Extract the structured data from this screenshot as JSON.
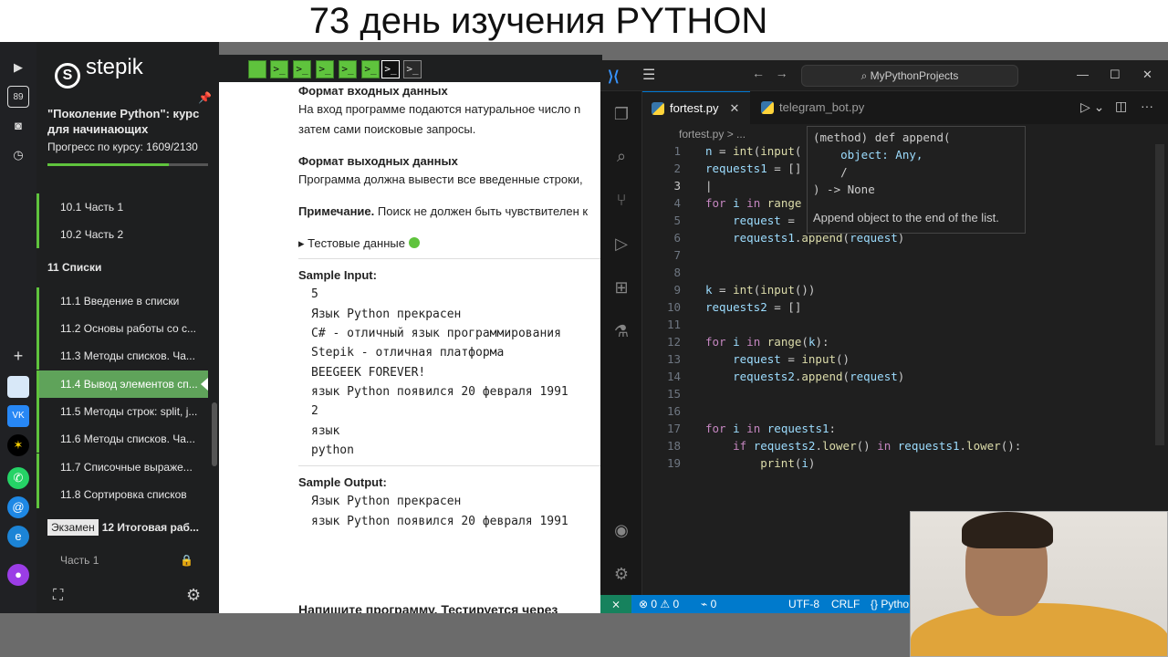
{
  "banner": {
    "title": "73 день изучения PYTHON"
  },
  "os_sidebar": {
    "badge": "89"
  },
  "stepik": {
    "logo": "stepik",
    "course_title": "\"Поколение Python\": курс для начинающих",
    "progress_text": "Прогресс по курсу:  1609/2130",
    "progress_value": 0.755,
    "menu": [
      {
        "label": "10.1  Часть 1",
        "type": "sub"
      },
      {
        "label": "10.2  Часть 2",
        "type": "sub"
      },
      {
        "label": "11  Списки",
        "type": "section"
      },
      {
        "label": "11.1  Введение в списки",
        "type": "sub"
      },
      {
        "label": "11.2  Основы работы со с...",
        "type": "sub"
      },
      {
        "label": "11.3  Методы списков. Ча...",
        "type": "sub"
      },
      {
        "label": "11.4  Вывод элементов сп...",
        "type": "active"
      },
      {
        "label": "11.5  Методы строк: split, j...",
        "type": "sub"
      },
      {
        "label": "11.6  Методы списков. Ча...",
        "type": "sub"
      },
      {
        "label": "11.7  Списочные выраже...",
        "type": "sub"
      },
      {
        "label": "11.8  Сортировка списков",
        "type": "sub"
      },
      {
        "label": "12  Итоговая раб...",
        "type": "exam",
        "badge": "Экзамен"
      },
      {
        "label": "Часть 1",
        "type": "locked"
      }
    ],
    "steps": [
      ">_",
      ">_",
      ">_",
      ">_",
      ">_",
      ">_",
      ">_"
    ],
    "content": {
      "input_format_title": "Формат входных данных",
      "input_format_line1": "На вход программе подаются натуральное число n",
      "input_format_line2": "затем сами поисковые запросы.",
      "output_format_title": "Формат выходных данных",
      "output_format_text": "Программа должна вывести все введенные строки,",
      "note_bold": "Примечание.",
      "note_text": " Поиск не должен быть чувствителен к",
      "tests_label": "Тестовые данные",
      "sample_input_title": "Sample Input:",
      "sample_input": [
        "5",
        "Язык Python прекрасен",
        "C# - отличный язык программирования",
        "Stepik - отличная платформа",
        "BEEGEEK FOREVER!",
        "язык Python появился 20 февраля 1991",
        "2",
        "язык",
        "python"
      ],
      "sample_output_title": "Sample Output:",
      "sample_output": [
        "Язык Python прекрасен",
        "язык Python появился 20 февраля 1991"
      ],
      "next_task": "Напишите программу. Тестируется через"
    }
  },
  "vscode": {
    "search": "MyPythonProjects",
    "tabs": [
      {
        "label": "fortest.py",
        "active": true
      },
      {
        "label": "telegram_bot.py",
        "active": false
      }
    ],
    "breadcrumb": "fortest.py > ...",
    "line_numbers": [
      "1",
      "2",
      "3",
      "4",
      "5",
      "6",
      "7",
      "8",
      "9",
      "10",
      "11",
      "12",
      "13",
      "14",
      "15",
      "16",
      "17",
      "18",
      "19"
    ],
    "hover": {
      "line1": "(method) def append(",
      "line2": "    object: Any,",
      "line3": "    /",
      "line4": ") -> None",
      "doc": "Append object to the end of the list."
    },
    "status": {
      "errors": "0",
      "warnings": "0",
      "ports": "0",
      "encoding": "UTF-8",
      "eol": "CRLF",
      "language": "Pytho"
    }
  },
  "colors": {
    "accent_green": "#5fc33d",
    "vscode_blue": "#007acc"
  }
}
